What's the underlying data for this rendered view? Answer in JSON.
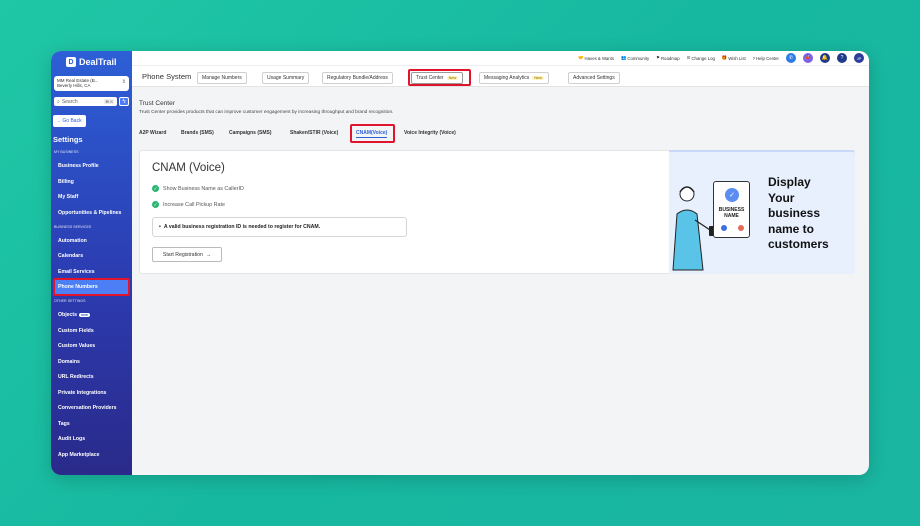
{
  "brand": {
    "name": "DealTrail"
  },
  "account": {
    "name": "MM Real Estate (B...",
    "location": "Beverly Hills, CA"
  },
  "sidebar": {
    "search_placeholder": "Search",
    "search_shortcut": "⌘ K",
    "go_back": "Go Back",
    "settings_title": "Settings",
    "sections": {
      "my_business": "MY BUSINESS",
      "business_services": "BUSINESS SERVICES",
      "other_settings": "OTHER SETTINGS"
    },
    "items": {
      "business_profile": "Business Profile",
      "billing": "Billing",
      "my_staff": "My Staff",
      "opportunities": "Opportunities & Pipelines",
      "automation": "Automation",
      "calendars": "Calendars",
      "email_services": "Email Services",
      "phone_numbers": "Phone Numbers",
      "objects": "Objects",
      "objects_badge": "new",
      "custom_fields": "Custom Fields",
      "custom_values": "Custom Values",
      "domains": "Domains",
      "url_redirects": "URL Redirects",
      "private_integrations": "Private Integrations",
      "conversation_providers": "Conversation Providers",
      "tags": "Tags",
      "audit_logs": "Audit Logs",
      "app_marketplace": "App Marketplace"
    }
  },
  "topbar": {
    "links": {
      "haves_wants": "Haves & Wants",
      "community": "Community",
      "roadmap": "Roadmap",
      "change_log": "Change Log",
      "wish_list": "Wish List",
      "help_center": "Help Center"
    },
    "avatar_initials": "JP"
  },
  "subnav": {
    "title": "Phone System",
    "tabs": {
      "manage_numbers": "Manage Numbers",
      "usage_summary": "Usage Summary",
      "regulatory": "Regulatory Bundle/Address",
      "trust_center": "Trust Center",
      "messaging_analytics": "Messaging Analytics",
      "advanced_settings": "Advanced Settings"
    },
    "new_badge": "New"
  },
  "content": {
    "title": "Trust Center",
    "description": "Trust Center provides products that can improve customer engagement by increasing throughput and brand recognition.",
    "tabs": {
      "a2p": "A2P Wizard",
      "brands": "Brands (SMS)",
      "campaigns": "Campaigns (SMS)",
      "shaken": "Shaken/STIR (Voice)",
      "cnam": "CNAM(Voice)",
      "voice_integrity": "Voice Integrity (Voice)"
    }
  },
  "card": {
    "title": "CNAM (Voice)",
    "features": [
      "Show Business Name as CallerID",
      "Increase Call Pickup Rate"
    ],
    "notice": "A valid business registration ID is needed to register for CNAM.",
    "start_button": "Start Registration",
    "promo_lines": [
      "Display",
      "Your",
      "business",
      "name to",
      "customers"
    ],
    "illustration_label": "BUSINESS NAME"
  },
  "colors": {
    "accent": "#2d5fd6",
    "highlight": "#e0142c",
    "success": "#2bb673"
  }
}
